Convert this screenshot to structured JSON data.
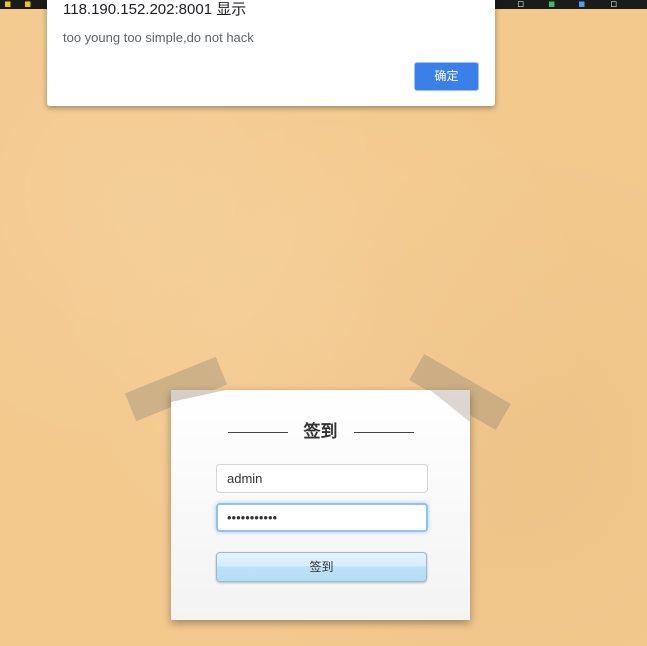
{
  "alert": {
    "title": "118.190.152.202:8001 显示",
    "message": "too young too simple,do not hack",
    "ok_label": "确定"
  },
  "login": {
    "heading": "签到",
    "username_value": "admin",
    "password_value": "•••••••••••",
    "submit_label": "签到"
  },
  "colors": {
    "background": "#f3c98e",
    "accent": "#3b7fe8",
    "focus": "#8cc3f2"
  }
}
